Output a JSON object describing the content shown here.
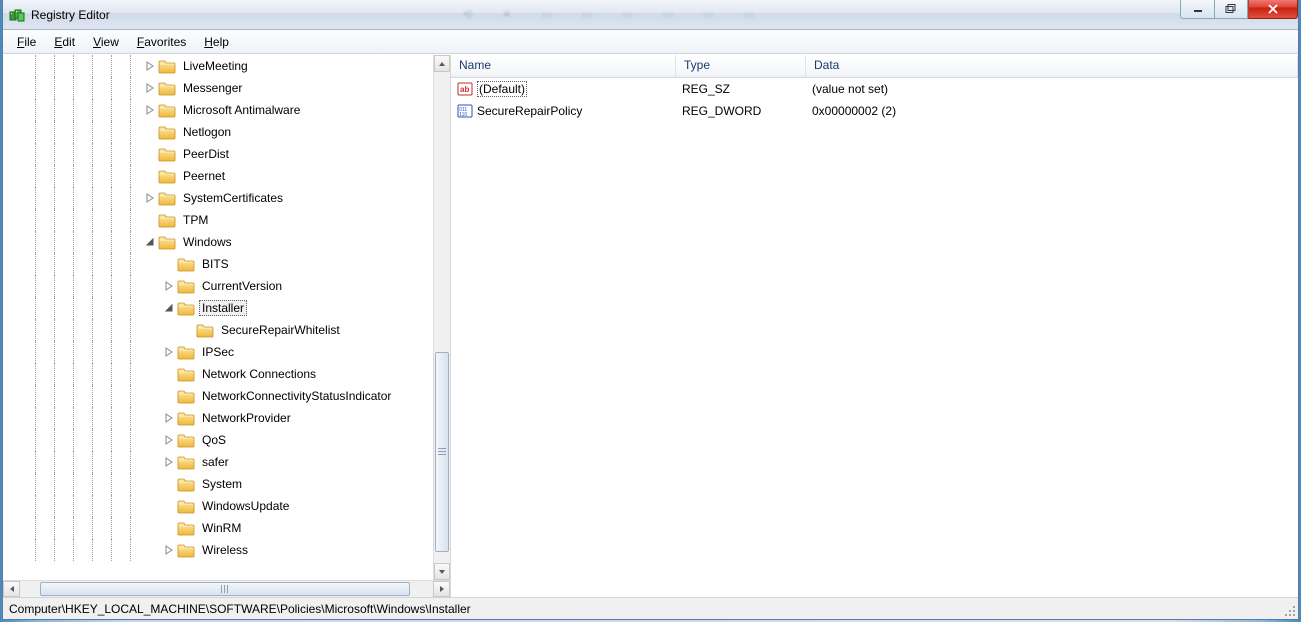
{
  "window": {
    "title": "Registry Editor"
  },
  "menu": {
    "file": "File",
    "edit": "Edit",
    "view": "View",
    "favorites": "Favorites",
    "help": "Help"
  },
  "tree": {
    "items": [
      {
        "level": 7,
        "expand": "closed",
        "label": "LiveMeeting"
      },
      {
        "level": 7,
        "expand": "closed",
        "label": "Messenger"
      },
      {
        "level": 7,
        "expand": "closed",
        "label": "Microsoft Antimalware"
      },
      {
        "level": 7,
        "expand": "none",
        "label": "Netlogon"
      },
      {
        "level": 7,
        "expand": "none",
        "label": "PeerDist"
      },
      {
        "level": 7,
        "expand": "none",
        "label": "Peernet"
      },
      {
        "level": 7,
        "expand": "closed",
        "label": "SystemCertificates"
      },
      {
        "level": 7,
        "expand": "none",
        "label": "TPM"
      },
      {
        "level": 7,
        "expand": "open",
        "label": "Windows"
      },
      {
        "level": 8,
        "expand": "none",
        "label": "BITS"
      },
      {
        "level": 8,
        "expand": "closed",
        "label": "CurrentVersion"
      },
      {
        "level": 8,
        "expand": "open",
        "label": "Installer",
        "selected": true
      },
      {
        "level": 9,
        "expand": "none",
        "label": "SecureRepairWhitelist"
      },
      {
        "level": 8,
        "expand": "closed",
        "label": "IPSec"
      },
      {
        "level": 8,
        "expand": "none",
        "label": "Network Connections"
      },
      {
        "level": 8,
        "expand": "none",
        "label": "NetworkConnectivityStatusIndicator"
      },
      {
        "level": 8,
        "expand": "closed",
        "label": "NetworkProvider"
      },
      {
        "level": 8,
        "expand": "closed",
        "label": "QoS"
      },
      {
        "level": 8,
        "expand": "closed",
        "label": "safer"
      },
      {
        "level": 8,
        "expand": "none",
        "label": "System"
      },
      {
        "level": 8,
        "expand": "none",
        "label": "WindowsUpdate"
      },
      {
        "level": 8,
        "expand": "none",
        "label": "WinRM"
      },
      {
        "level": 8,
        "expand": "closed",
        "label": "Wireless"
      }
    ]
  },
  "list": {
    "columns": {
      "name": "Name",
      "type": "Type",
      "data": "Data"
    },
    "rows": [
      {
        "icon": "string",
        "name": "(Default)",
        "type": "REG_SZ",
        "data": "(value not set)",
        "selected": true
      },
      {
        "icon": "binary",
        "name": "SecureRepairPolicy",
        "type": "REG_DWORD",
        "data": "0x00000002 (2)"
      }
    ]
  },
  "statusbar": {
    "path": "Computer\\HKEY_LOCAL_MACHINE\\SOFTWARE\\Policies\\Microsoft\\Windows\\Installer"
  }
}
